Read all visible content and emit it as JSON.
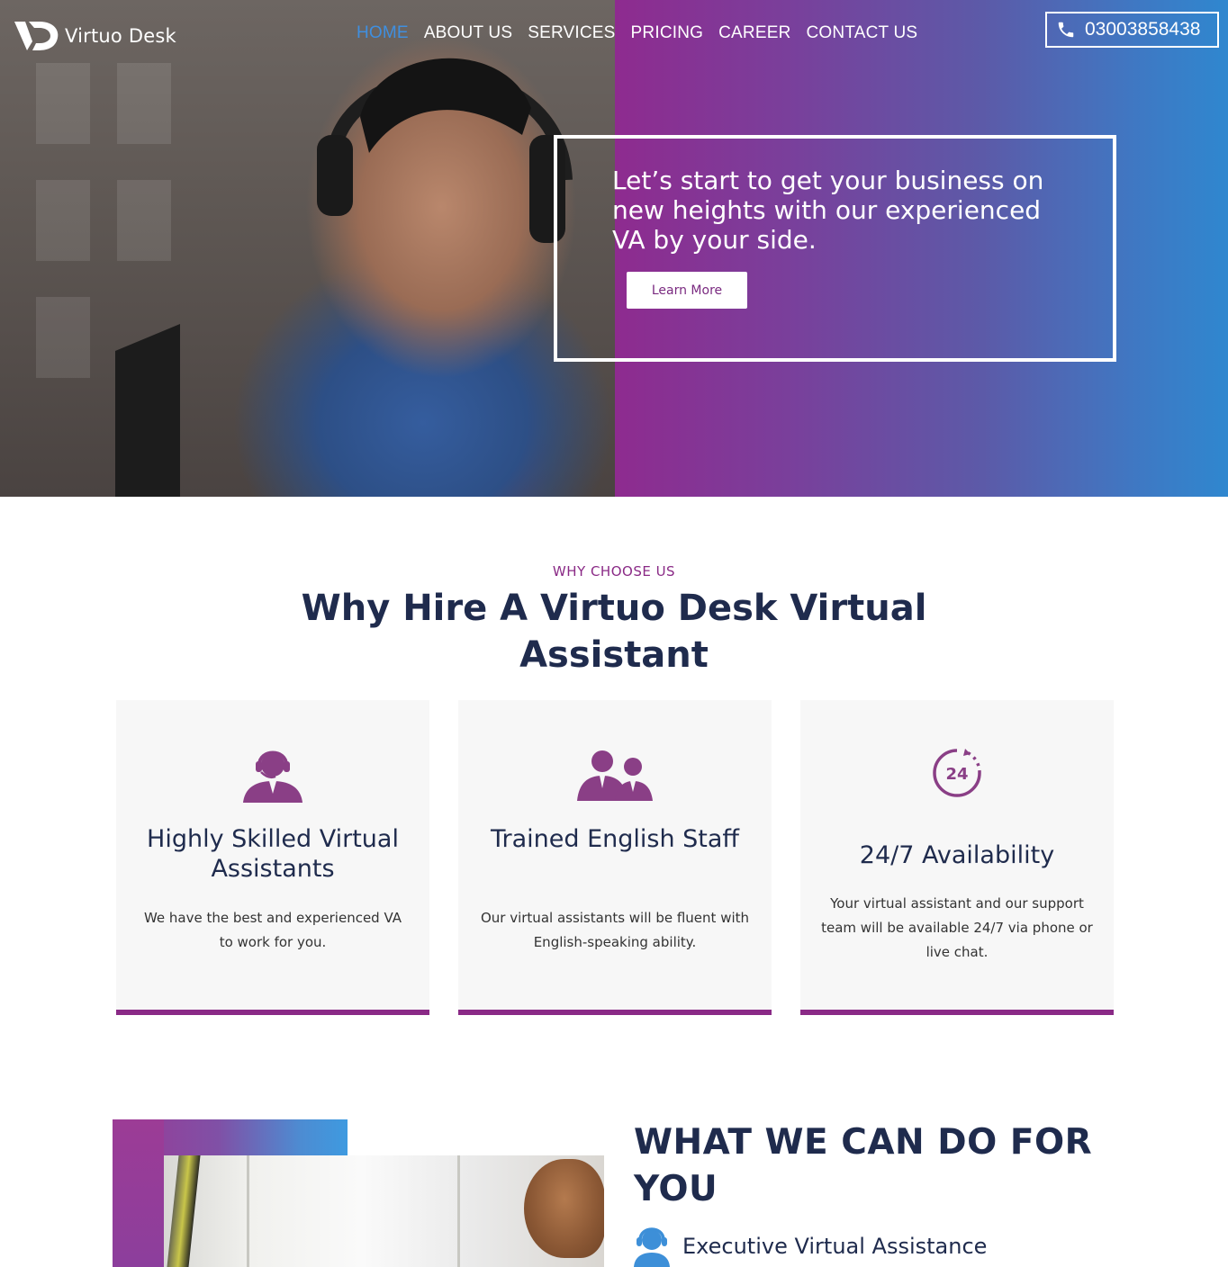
{
  "brand": {
    "name": "Virtuo Desk"
  },
  "nav": {
    "items": [
      {
        "label": "HOME",
        "active": true
      },
      {
        "label": "ABOUT US"
      },
      {
        "label": "SERVICES"
      },
      {
        "label": "PRICING"
      },
      {
        "label": "CAREER"
      },
      {
        "label": "CONTACT US"
      }
    ],
    "phone": "03003858438"
  },
  "hero": {
    "heading": "Let’s start to get your business on new heights with our experienced VA by your side.",
    "button_label": "Learn More"
  },
  "why": {
    "eyebrow": "WHY CHOOSE US",
    "title": "Why Hire A Virtuo Desk Virtual Assistant",
    "cards": [
      {
        "icon": "headset-agent-icon",
        "title": "Highly Skilled Virtual Assistants",
        "desc": "We have the best and experienced VA to work for you."
      },
      {
        "icon": "team-staff-icon",
        "title": "Trained English Staff",
        "desc": "Our virtual assistants will be fluent with English-speaking ability."
      },
      {
        "icon": "24-hours-icon",
        "title": "24/7 Availability",
        "desc": "Your virtual assistant and our support team will be available 24/7 via phone or live chat."
      }
    ]
  },
  "what_we_do": {
    "title": "WHAT WE CAN DO FOR YOU",
    "services": [
      {
        "icon": "support-agent-icon",
        "label": "Executive Virtual Assistance"
      }
    ]
  },
  "colors": {
    "accent_purple": "#8a2a86",
    "accent_blue": "#3f8fe0",
    "heading_navy": "#1f2b4d"
  }
}
